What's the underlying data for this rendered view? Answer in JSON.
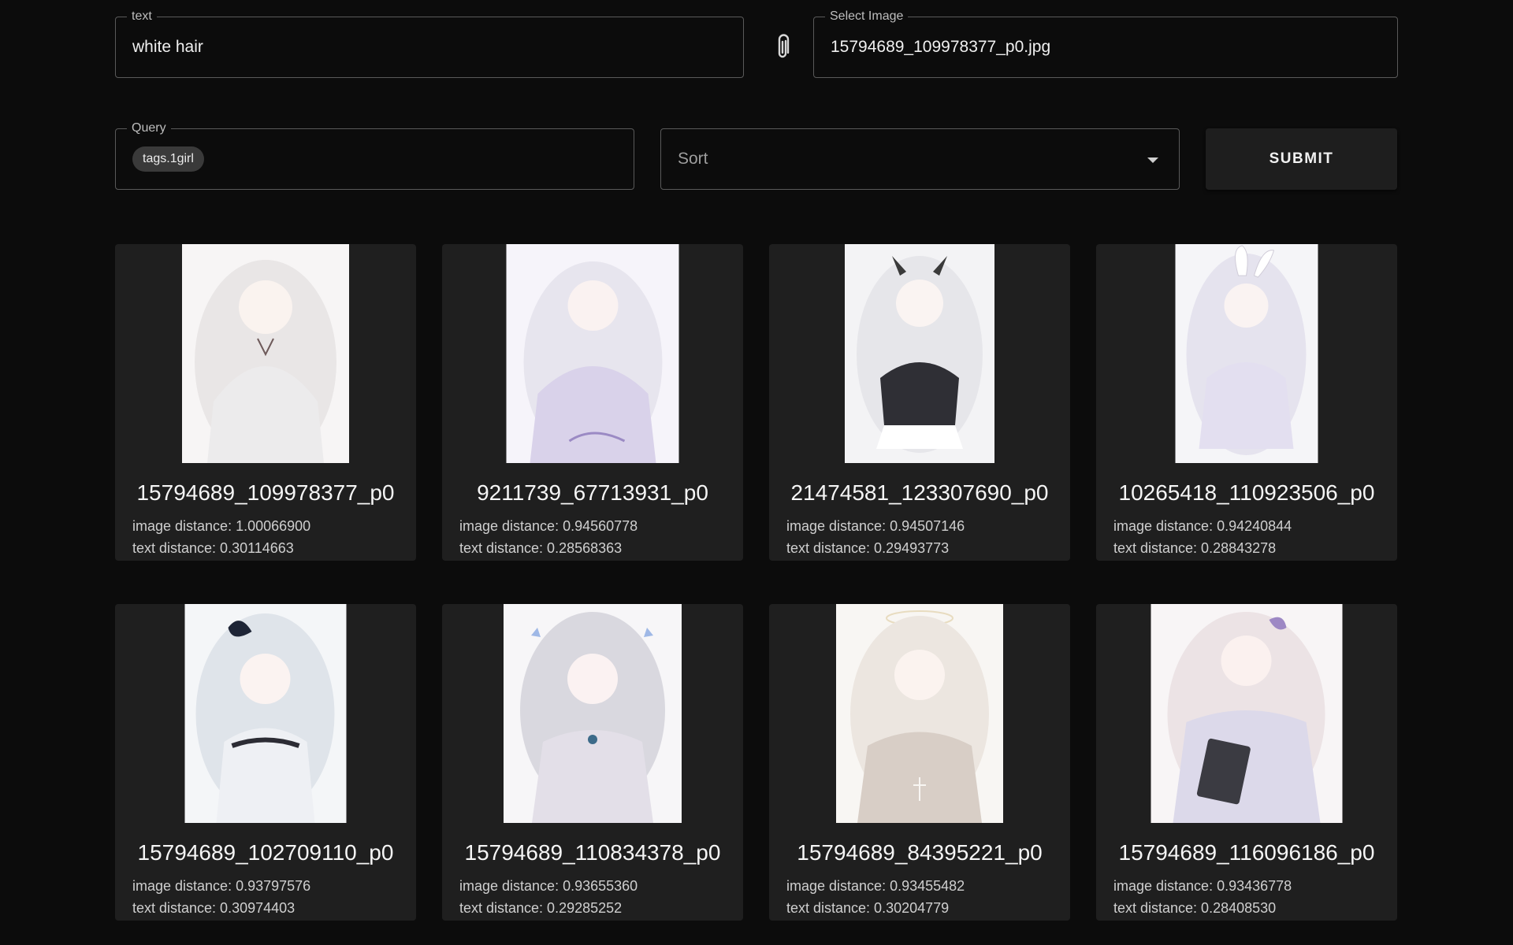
{
  "search": {
    "text_label": "text",
    "text_value": "white hair",
    "image_label": "Select Image",
    "image_value": "15794689_109978377_p0.jpg",
    "query_label": "Query",
    "query_chip": "tags.1girl",
    "sort_placeholder": "Sort",
    "submit_label": "SUBMIT"
  },
  "results": [
    {
      "title": "15794689_109978377_p0",
      "image_distance": "image distance: 1.00066900",
      "text_distance": "text distance: 0.30114663"
    },
    {
      "title": "9211739_67713931_p0",
      "image_distance": "image distance: 0.94560778",
      "text_distance": "text distance: 0.28568363"
    },
    {
      "title": "21474581_123307690_p0",
      "image_distance": "image distance: 0.94507146",
      "text_distance": "text distance: 0.29493773"
    },
    {
      "title": "10265418_110923506_p0",
      "image_distance": "image distance: 0.94240844",
      "text_distance": "text distance: 0.28843278"
    },
    {
      "title": "15794689_102709110_p0",
      "image_distance": "image distance: 0.93797576",
      "text_distance": "text distance: 0.30974403"
    },
    {
      "title": "15794689_110834378_p0",
      "image_distance": "image distance: 0.93655360",
      "text_distance": "text distance: 0.29285252"
    },
    {
      "title": "15794689_84395221_p0",
      "image_distance": "image distance: 0.93455482",
      "text_distance": "text distance: 0.30204779"
    },
    {
      "title": "15794689_116096186_p0",
      "image_distance": "image distance: 0.93436778",
      "text_distance": "text distance: 0.28408530"
    }
  ],
  "icons": {
    "attach": "paperclip-icon",
    "sort": "arrow-drop-down-icon"
  },
  "colors": {
    "background": "#0c0c0c",
    "card": "#1f1f1f",
    "chip": "#3a3a3a",
    "button": "#1e1e1e"
  }
}
